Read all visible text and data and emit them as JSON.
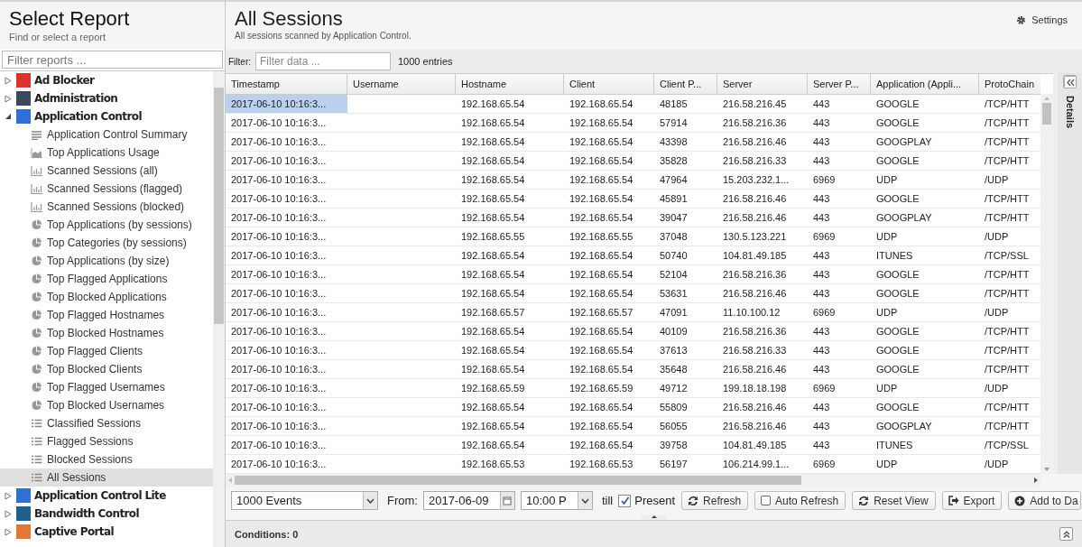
{
  "sidebar": {
    "title": "Select Report",
    "subtitle": "Find or select a report",
    "filter": {
      "placeholder": "Filter reports ..."
    },
    "groups": [
      {
        "label": "Ad Blocker",
        "expanded": false
      },
      {
        "label": "Administration",
        "expanded": false
      },
      {
        "label": "Application Control",
        "expanded": true,
        "children": [
          {
            "label": "Application Control Summary",
            "kind": "summary",
            "selected": false
          },
          {
            "label": "Top Applications Usage",
            "kind": "area",
            "selected": false
          },
          {
            "label": "Scanned Sessions (all)",
            "kind": "bar",
            "selected": false
          },
          {
            "label": "Scanned Sessions (flagged)",
            "kind": "bar",
            "selected": false
          },
          {
            "label": "Scanned Sessions (blocked)",
            "kind": "bar",
            "selected": false
          },
          {
            "label": "Top Applications (by sessions)",
            "kind": "pie",
            "selected": false
          },
          {
            "label": "Top Categories (by sessions)",
            "kind": "pie",
            "selected": false
          },
          {
            "label": "Top Applications (by size)",
            "kind": "pie",
            "selected": false
          },
          {
            "label": "Top Flagged Applications",
            "kind": "pie",
            "selected": false
          },
          {
            "label": "Top Blocked Applications",
            "kind": "pie",
            "selected": false
          },
          {
            "label": "Top Flagged Hostnames",
            "kind": "pie",
            "selected": false
          },
          {
            "label": "Top Blocked Hostnames",
            "kind": "pie",
            "selected": false
          },
          {
            "label": "Top Flagged Clients",
            "kind": "pie",
            "selected": false
          },
          {
            "label": "Top Blocked Clients",
            "kind": "pie",
            "selected": false
          },
          {
            "label": "Top Flagged Usernames",
            "kind": "pie",
            "selected": false
          },
          {
            "label": "Top Blocked Usernames",
            "kind": "pie",
            "selected": false
          },
          {
            "label": "Classified Sessions",
            "kind": "list",
            "selected": false
          },
          {
            "label": "Flagged Sessions",
            "kind": "list",
            "selected": false
          },
          {
            "label": "Blocked Sessions",
            "kind": "list",
            "selected": false
          },
          {
            "label": "All Sessions",
            "kind": "list",
            "selected": true
          }
        ]
      },
      {
        "label": "Application Control Lite",
        "expanded": false
      },
      {
        "label": "Bandwidth Control",
        "expanded": false
      },
      {
        "label": "Captive Portal",
        "expanded": false
      }
    ]
  },
  "report": {
    "title": "All Sessions",
    "subtitle": "All sessions scanned by Application Control.",
    "settings": "Settings",
    "filter_label": "Filter:",
    "filter": {
      "placeholder": "Filter data ..."
    },
    "entries": "1000 entries",
    "table": {
      "columns": [
        "Timestamp",
        "Username",
        "Hostname",
        "Client",
        "Client P...",
        "Server",
        "Server P...",
        "Application (Appli...",
        "ProtoChain"
      ],
      "rows": [
        {
          "selected": true,
          "cells": [
            "2017-06-10 10:16:3...",
            "",
            "192.168.65.54",
            "192.168.65.54",
            "48185",
            "216.58.216.45",
            "443",
            "GOOGLE",
            "/TCP/HTT"
          ]
        },
        {
          "selected": false,
          "cells": [
            "2017-06-10 10:16:3...",
            "",
            "192.168.65.54",
            "192.168.65.54",
            "57914",
            "216.58.216.36",
            "443",
            "GOOGLE",
            "/TCP/HTT"
          ]
        },
        {
          "selected": false,
          "cells": [
            "2017-06-10 10:16:3...",
            "",
            "192.168.65.54",
            "192.168.65.54",
            "43398",
            "216.58.216.46",
            "443",
            "GOOGPLAY",
            "/TCP/HTT"
          ]
        },
        {
          "selected": false,
          "cells": [
            "2017-06-10 10:16:3...",
            "",
            "192.168.65.54",
            "192.168.65.54",
            "35828",
            "216.58.216.33",
            "443",
            "GOOGLE",
            "/TCP/HTT"
          ]
        },
        {
          "selected": false,
          "cells": [
            "2017-06-10 10:16:3...",
            "",
            "192.168.65.54",
            "192.168.65.54",
            "47964",
            "15.203.232.1...",
            "6969",
            "UDP",
            "/UDP"
          ]
        },
        {
          "selected": false,
          "cells": [
            "2017-06-10 10:16:3...",
            "",
            "192.168.65.54",
            "192.168.65.54",
            "45891",
            "216.58.216.46",
            "443",
            "GOOGLE",
            "/TCP/HTT"
          ]
        },
        {
          "selected": false,
          "cells": [
            "2017-06-10 10:16:3...",
            "",
            "192.168.65.54",
            "192.168.65.54",
            "39047",
            "216.58.216.46",
            "443",
            "GOOGPLAY",
            "/TCP/HTT"
          ]
        },
        {
          "selected": false,
          "cells": [
            "2017-06-10 10:16:3...",
            "",
            "192.168.65.55",
            "192.168.65.55",
            "37048",
            "130.5.123.221",
            "6969",
            "UDP",
            "/UDP"
          ]
        },
        {
          "selected": false,
          "cells": [
            "2017-06-10 10:16:3...",
            "",
            "192.168.65.54",
            "192.168.65.54",
            "50740",
            "104.81.49.185",
            "443",
            "ITUNES",
            "/TCP/SSL"
          ]
        },
        {
          "selected": false,
          "cells": [
            "2017-06-10 10:16:3...",
            "",
            "192.168.65.54",
            "192.168.65.54",
            "52104",
            "216.58.216.36",
            "443",
            "GOOGLE",
            "/TCP/HTT"
          ]
        },
        {
          "selected": false,
          "cells": [
            "2017-06-10 10:16:3...",
            "",
            "192.168.65.54",
            "192.168.65.54",
            "53631",
            "216.58.216.46",
            "443",
            "GOOGLE",
            "/TCP/HTT"
          ]
        },
        {
          "selected": false,
          "cells": [
            "2017-06-10 10:16:3...",
            "",
            "192.168.65.57",
            "192.168.65.57",
            "47091",
            "11.10.100.12",
            "6969",
            "UDP",
            "/UDP"
          ]
        },
        {
          "selected": false,
          "cells": [
            "2017-06-10 10:16:3...",
            "",
            "192.168.65.54",
            "192.168.65.54",
            "40109",
            "216.58.216.36",
            "443",
            "GOOGLE",
            "/TCP/HTT"
          ]
        },
        {
          "selected": false,
          "cells": [
            "2017-06-10 10:16:3...",
            "",
            "192.168.65.54",
            "192.168.65.54",
            "37613",
            "216.58.216.33",
            "443",
            "GOOGLE",
            "/TCP/HTT"
          ]
        },
        {
          "selected": false,
          "cells": [
            "2017-06-10 10:16:3...",
            "",
            "192.168.65.54",
            "192.168.65.54",
            "35648",
            "216.58.216.46",
            "443",
            "GOOGLE",
            "/TCP/HTT"
          ]
        },
        {
          "selected": false,
          "cells": [
            "2017-06-10 10:16:3...",
            "",
            "192.168.65.59",
            "192.168.65.59",
            "49712",
            "199.18.18.198",
            "6969",
            "UDP",
            "/UDP"
          ]
        },
        {
          "selected": false,
          "cells": [
            "2017-06-10 10:16:3...",
            "",
            "192.168.65.54",
            "192.168.65.54",
            "55809",
            "216.58.216.46",
            "443",
            "GOOGLE",
            "/TCP/HTT"
          ]
        },
        {
          "selected": false,
          "cells": [
            "2017-06-10 10:16:3...",
            "",
            "192.168.65.54",
            "192.168.65.54",
            "56055",
            "216.58.216.46",
            "443",
            "GOOGPLAY",
            "/TCP/HTT"
          ]
        },
        {
          "selected": false,
          "cells": [
            "2017-06-10 10:16:3...",
            "",
            "192.168.65.54",
            "192.168.65.54",
            "39758",
            "104.81.49.185",
            "443",
            "ITUNES",
            "/TCP/SSL"
          ]
        },
        {
          "selected": false,
          "cells": [
            "2017-06-10 10:16:3...",
            "",
            "192.168.65.53",
            "192.168.65.53",
            "56197",
            "106.214.99.1...",
            "6969",
            "UDP",
            "/UDP"
          ]
        }
      ]
    },
    "toolbar": {
      "events": "1000 Events",
      "from_label": "From:",
      "date": "2017-06-09",
      "time": "10:00 P",
      "till_label": "till",
      "present": {
        "label": "Present",
        "checked": true
      },
      "buttons": [
        {
          "label": "Refresh",
          "kind": "refresh"
        },
        {
          "label": "Auto Refresh",
          "kind": "checkbox",
          "checked": false
        },
        {
          "label": "Reset View",
          "kind": "refresh"
        },
        {
          "label": "Export",
          "kind": "export"
        },
        {
          "label": "Add to Da",
          "kind": "add"
        }
      ]
    },
    "conditions": "Conditions: 0",
    "details": "Details"
  }
}
